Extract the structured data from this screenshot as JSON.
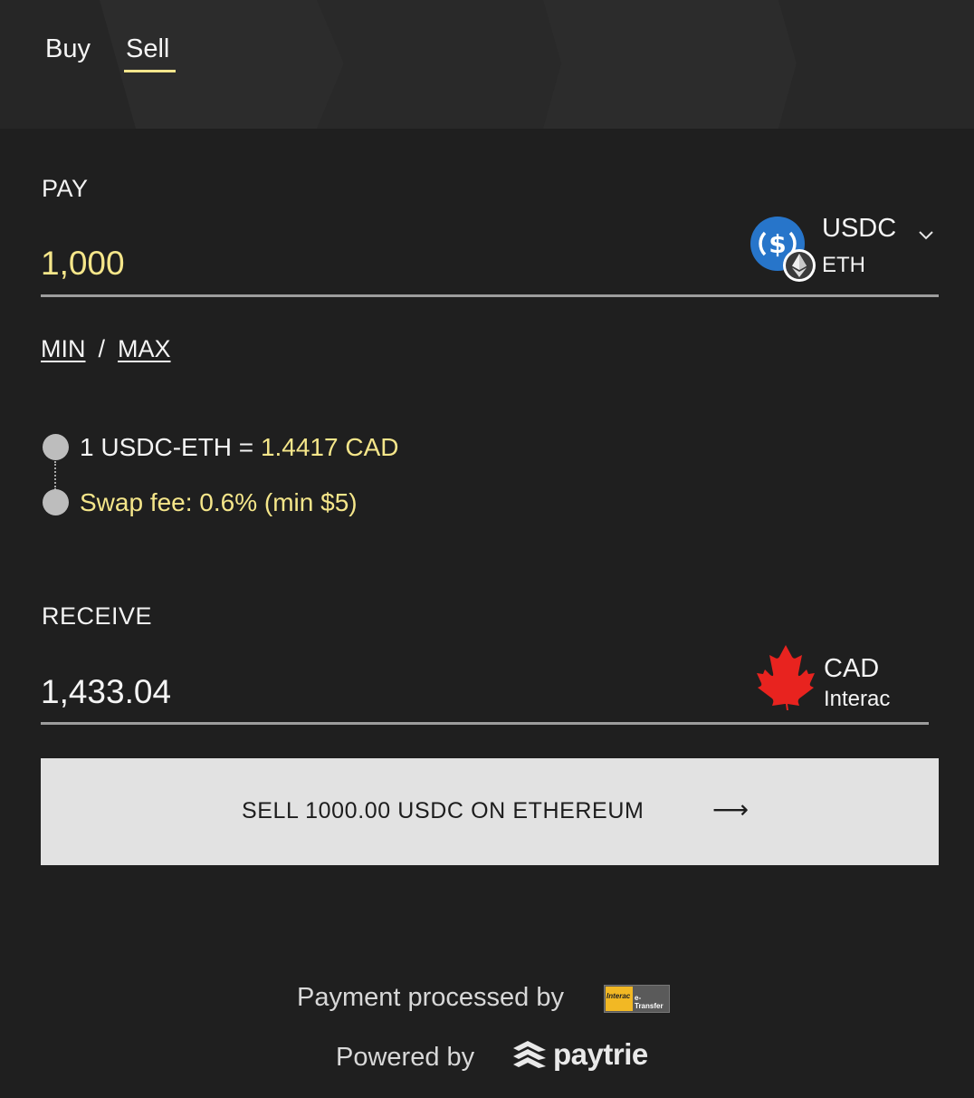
{
  "tabs": {
    "buy": "Buy",
    "sell": "Sell",
    "active": "sell"
  },
  "pay": {
    "label": "PAY",
    "amount": "1,000",
    "asset": "USDC",
    "network": "ETH"
  },
  "limits": {
    "min": "MIN",
    "separator": "/",
    "max": "MAX"
  },
  "rate": {
    "prefix": "1 USDC-ETH = ",
    "value": "1.4417 CAD"
  },
  "fee": {
    "text": "Swap fee: 0.6% (min $5)"
  },
  "receive": {
    "label": "RECEIVE",
    "amount": "1,433.04",
    "asset": "CAD",
    "method": "Interac"
  },
  "action": {
    "label": "SELL 1000.00 USDC ON ETHEREUM",
    "arrow": "⟶"
  },
  "footer": {
    "payment_processed": "Payment processed by",
    "interac_logo_text": "Interac",
    "etransfer_text": "e-Transfer",
    "powered_by": "Powered by",
    "brand": "paytrie"
  },
  "colors": {
    "background": "#1f1f1f",
    "header": "#2a2a2a",
    "accent_yellow": "#f5e68a",
    "usdc_blue": "#2775ca",
    "maple_red": "#e8231f",
    "button_bg": "#e2e2e2"
  },
  "icons": {
    "pay_asset": "usdc-coin-icon",
    "pay_network": "ethereum-icon",
    "dropdown": "chevron-down-icon",
    "receive_asset": "maple-leaf-icon",
    "brand": "paytrie-logo-icon"
  }
}
